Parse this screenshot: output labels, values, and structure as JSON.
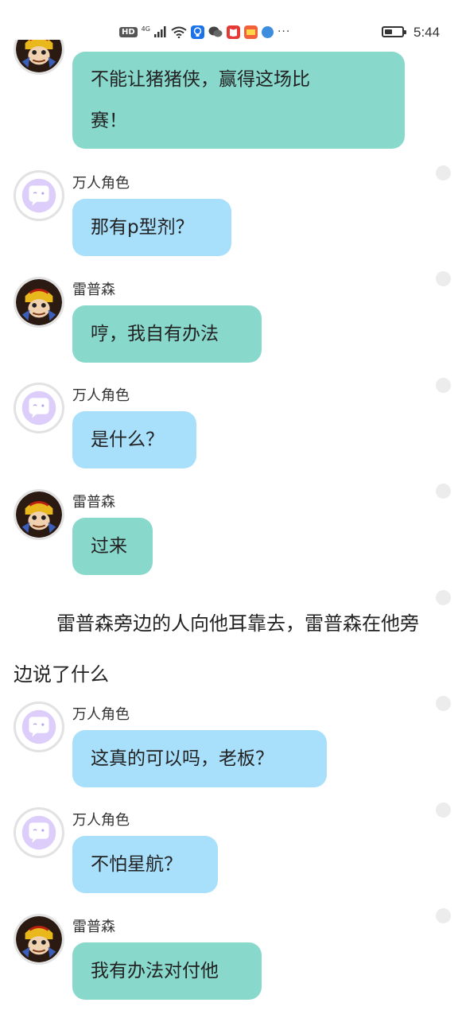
{
  "status_bar": {
    "hd": "HD",
    "network": "4G",
    "icons": [
      "signal-icon",
      "wifi-icon",
      "bulb-app-icon",
      "wechat-icon",
      "book-app-icon",
      "photo-app-icon",
      "browser-icon"
    ],
    "more": "···",
    "battery_level_percent": 45,
    "time": "5:44"
  },
  "colors": {
    "bubble_green": "#89d8cc",
    "bubble_blue": "#a8dffb"
  },
  "messages": [
    {
      "speaker": "",
      "text_lines": [
        "不能让猪猪侠，赢得这场比",
        "赛！"
      ],
      "avatar": "leipusen-avatar"
    },
    {
      "speaker": "万人角色",
      "text": "那有p型剂？",
      "avatar": "chat-bubble-avatar"
    },
    {
      "speaker": "雷普森",
      "text": "哼，我自有办法",
      "avatar": "leipusen-avatar"
    },
    {
      "speaker": "万人角色",
      "text": "是什么？",
      "avatar": "chat-bubble-avatar"
    },
    {
      "speaker": "雷普森",
      "text": "过来",
      "avatar": "leipusen-avatar"
    },
    {
      "speaker": "万人角色",
      "text": "这真的可以吗，老板？",
      "avatar": "chat-bubble-avatar"
    },
    {
      "speaker": "万人角色",
      "text": "不怕星航？",
      "avatar": "chat-bubble-avatar"
    },
    {
      "speaker": "雷普森",
      "text": "我有办法对付他",
      "avatar": "leipusen-avatar"
    }
  ],
  "narration": "雷普森旁边的人向他耳靠去，雷普森在他旁边说了什么"
}
